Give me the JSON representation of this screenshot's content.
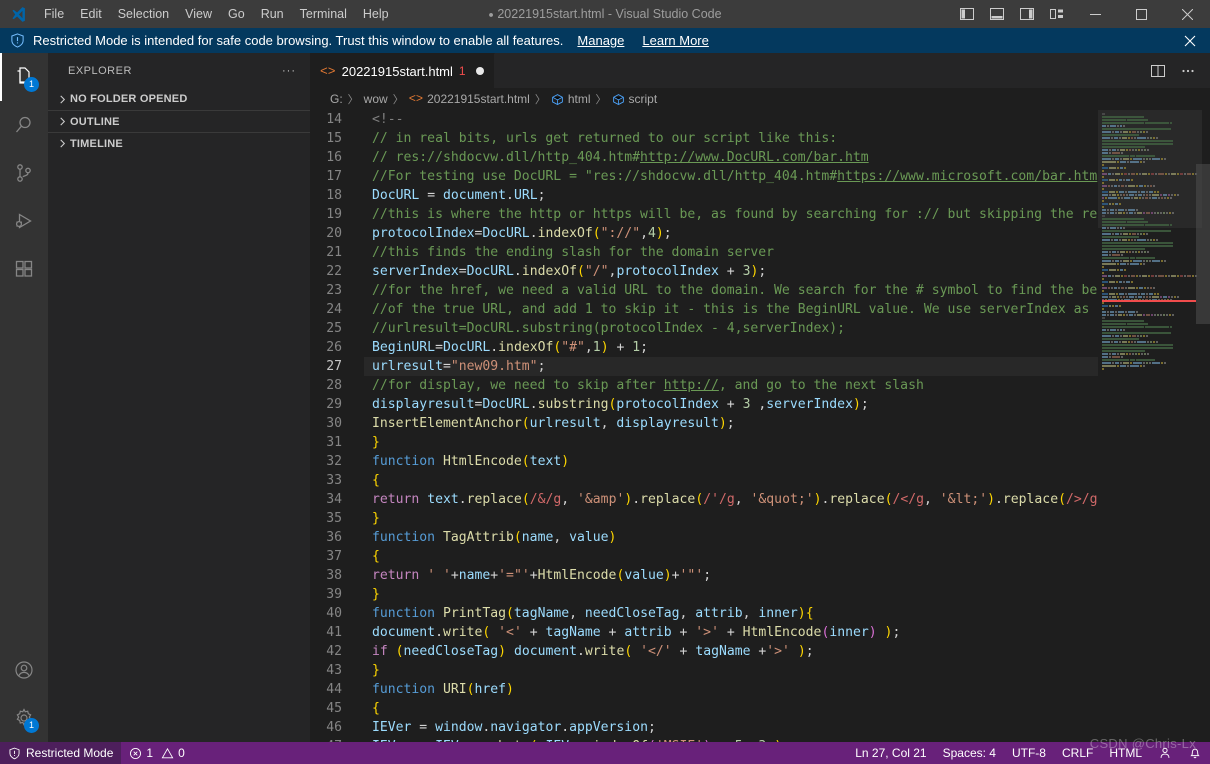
{
  "titlebar": {
    "menu": [
      "File",
      "Edit",
      "Selection",
      "View",
      "Go",
      "Run",
      "Terminal",
      "Help"
    ],
    "title": "20221915start.html - Visual Studio Code",
    "dirty_marker": "●",
    "layout_icons": [
      "toggle-primary-sidebar",
      "toggle-panel",
      "toggle-secondary-sidebar",
      "customize-layout"
    ],
    "window_controls": [
      "minimize",
      "maximize",
      "close"
    ]
  },
  "banner": {
    "text": "Restricted Mode is intended for safe code browsing. Trust this window to enable all features.",
    "links": [
      "Manage",
      "Learn More"
    ],
    "close_label": "✕",
    "bg": "#04395e"
  },
  "activitybar": {
    "items": [
      {
        "name": "explorer",
        "badge": "1",
        "active": true
      },
      {
        "name": "search",
        "badge": "",
        "active": false
      },
      {
        "name": "source-control",
        "badge": "",
        "active": false
      },
      {
        "name": "run-and-debug",
        "badge": "",
        "active": false
      },
      {
        "name": "extensions",
        "badge": "",
        "active": false
      }
    ],
    "bottom": [
      {
        "name": "accounts",
        "badge": ""
      },
      {
        "name": "manage-settings",
        "badge": "1"
      }
    ]
  },
  "sidebar": {
    "title": "EXPLORER",
    "more_actions": "···",
    "sections": [
      {
        "label": "NO FOLDER OPENED",
        "expanded": false
      },
      {
        "label": "OUTLINE",
        "expanded": false
      },
      {
        "label": "TIMELINE",
        "expanded": false
      }
    ]
  },
  "editor": {
    "tab": {
      "filename": "20221915start.html",
      "error_count": "1",
      "dirty": true,
      "icon": "<>"
    },
    "actions": [
      "split-editor-right",
      "more-actions"
    ],
    "breadcrumbs": [
      {
        "label": "G:",
        "icon": ""
      },
      {
        "label": "wow",
        "icon": ""
      },
      {
        "label": "20221915start.html",
        "icon": "code"
      },
      {
        "label": "html",
        "icon": "symbol"
      },
      {
        "label": "script",
        "icon": "symbol"
      }
    ],
    "separator": "〉",
    "current_line": 27,
    "first_visible_line": 14,
    "lines": [
      {
        "n": 14,
        "tokens": [
          [
            "tg",
            "<!--"
          ]
        ]
      },
      {
        "n": 15,
        "tokens": [
          [
            "c",
            "// in real bits, urls get returned to our script like this:"
          ]
        ]
      },
      {
        "n": 16,
        "tokens": [
          [
            "c",
            "// res://shdocvw.dll/http_404.htm#"
          ],
          [
            "cu",
            "http://www.DocURL.com/bar.htm"
          ]
        ]
      },
      {
        "n": 17,
        "tokens": [
          [
            "c",
            "//For testing use DocURL = \"res://shdocvw.dll/http_404.htm#"
          ],
          [
            "cu",
            "https://www.microsoft.com/bar.htm"
          ],
          [
            "c",
            "\""
          ]
        ]
      },
      {
        "n": 18,
        "tokens": [
          [
            "vr",
            "DocURL"
          ],
          [
            "op",
            " = "
          ],
          [
            "vr",
            "document"
          ],
          [
            "op",
            "."
          ],
          [
            "vr",
            "URL"
          ],
          [
            "op",
            ";"
          ]
        ]
      },
      {
        "n": 19,
        "tokens": [
          [
            "c",
            "//this is where the http or https will be, as found by searching for :// but skipping the res://"
          ]
        ]
      },
      {
        "n": 20,
        "tokens": [
          [
            "vr",
            "protocolIndex"
          ],
          [
            "op",
            "="
          ],
          [
            "vr",
            "DocURL"
          ],
          [
            "op",
            "."
          ],
          [
            "fn",
            "indexOf"
          ],
          [
            "br1",
            "("
          ],
          [
            "st",
            "\"://\""
          ],
          [
            "op",
            ","
          ],
          [
            "nu",
            "4"
          ],
          [
            "br1",
            ")"
          ],
          [
            "op",
            ";"
          ]
        ]
      },
      {
        "n": 21,
        "tokens": [
          [
            "c",
            "//this finds the ending slash for the domain server"
          ]
        ]
      },
      {
        "n": 22,
        "tokens": [
          [
            "vr",
            "serverIndex"
          ],
          [
            "op",
            "="
          ],
          [
            "vr",
            "DocURL"
          ],
          [
            "op",
            "."
          ],
          [
            "fn",
            "indexOf"
          ],
          [
            "br1",
            "("
          ],
          [
            "st",
            "\"/\""
          ],
          [
            "op",
            ","
          ],
          [
            "vr",
            "protocolIndex"
          ],
          [
            "op",
            " + "
          ],
          [
            "nu",
            "3"
          ],
          [
            "br1",
            ")"
          ],
          [
            "op",
            ";"
          ]
        ]
      },
      {
        "n": 23,
        "tokens": [
          [
            "c",
            "//for the href, we need a valid URL to the domain. We search for the # symbol to find the beginning"
          ]
        ]
      },
      {
        "n": 24,
        "tokens": [
          [
            "c",
            "//of the true URL, and add 1 to skip it - this is the BeginURL value. We use serverIndex as the end"
          ]
        ]
      },
      {
        "n": 25,
        "tokens": [
          [
            "c",
            "//urlresult=DocURL.substring(protocolIndex - 4,serverIndex);"
          ]
        ]
      },
      {
        "n": 26,
        "tokens": [
          [
            "vr",
            "BeginURL"
          ],
          [
            "op",
            "="
          ],
          [
            "vr",
            "DocURL"
          ],
          [
            "op",
            "."
          ],
          [
            "fn",
            "indexOf"
          ],
          [
            "br1",
            "("
          ],
          [
            "st",
            "\"#\""
          ],
          [
            "op",
            ","
          ],
          [
            "nu",
            "1"
          ],
          [
            "br1",
            ")"
          ],
          [
            "op",
            " + "
          ],
          [
            "nu",
            "1"
          ],
          [
            "op",
            ";"
          ]
        ]
      },
      {
        "n": 27,
        "tokens": [
          [
            "vr",
            "urlresult"
          ],
          [
            "op",
            "="
          ],
          [
            "st",
            "\"new09.htm\""
          ],
          [
            "op",
            ";"
          ]
        ]
      },
      {
        "n": 28,
        "tokens": [
          [
            "c",
            "//for display, we need to skip after "
          ],
          [
            "cu",
            "http://"
          ],
          [
            "c",
            ", and go to the next slash"
          ]
        ]
      },
      {
        "n": 29,
        "tokens": [
          [
            "vr",
            "displayresult"
          ],
          [
            "op",
            "="
          ],
          [
            "vr",
            "DocURL"
          ],
          [
            "op",
            "."
          ],
          [
            "fn",
            "substring"
          ],
          [
            "br1",
            "("
          ],
          [
            "vr",
            "protocolIndex"
          ],
          [
            "op",
            " + "
          ],
          [
            "nu",
            "3"
          ],
          [
            "op",
            " ,"
          ],
          [
            "vr",
            "serverIndex"
          ],
          [
            "br1",
            ")"
          ],
          [
            "op",
            ";"
          ]
        ]
      },
      {
        "n": 30,
        "tokens": [
          [
            "fn",
            "InsertElementAnchor"
          ],
          [
            "br1",
            "("
          ],
          [
            "vr",
            "urlresult"
          ],
          [
            "op",
            ", "
          ],
          [
            "vr",
            "displayresult"
          ],
          [
            "br1",
            ")"
          ],
          [
            "op",
            ";"
          ]
        ]
      },
      {
        "n": 31,
        "tokens": [
          [
            "br1",
            "}"
          ]
        ]
      },
      {
        "n": 32,
        "tokens": [
          [
            "kw",
            "function "
          ],
          [
            "fn",
            "HtmlEncode"
          ],
          [
            "br1",
            "("
          ],
          [
            "vr",
            "text"
          ],
          [
            "br1",
            ")"
          ]
        ]
      },
      {
        "n": 33,
        "tokens": [
          [
            "br1",
            "{"
          ]
        ]
      },
      {
        "n": 34,
        "tokens": [
          [
            "pu",
            "return "
          ],
          [
            "vr",
            "text"
          ],
          [
            "op",
            "."
          ],
          [
            "fn",
            "replace"
          ],
          [
            "br1",
            "("
          ],
          [
            "rx",
            "/&/g"
          ],
          [
            "op",
            ", "
          ],
          [
            "st",
            "'&amp'"
          ],
          [
            "br1",
            ")"
          ],
          [
            "op",
            "."
          ],
          [
            "fn",
            "replace"
          ],
          [
            "br1",
            "("
          ],
          [
            "rx",
            "/'/g"
          ],
          [
            "op",
            ", "
          ],
          [
            "st",
            "'&quot;'"
          ],
          [
            "br1",
            ")"
          ],
          [
            "op",
            "."
          ],
          [
            "fn",
            "replace"
          ],
          [
            "br1",
            "("
          ],
          [
            "rx",
            "/</g"
          ],
          [
            "op",
            ", "
          ],
          [
            "st",
            "'&lt;'"
          ],
          [
            "br1",
            ")"
          ],
          [
            "op",
            "."
          ],
          [
            "fn",
            "replace"
          ],
          [
            "br1",
            "("
          ],
          [
            "rx",
            "/>/g"
          ],
          [
            "op",
            ", "
          ],
          [
            "st",
            "'"
          ]
        ]
      },
      {
        "n": 35,
        "tokens": [
          [
            "br1",
            "}"
          ]
        ]
      },
      {
        "n": 36,
        "tokens": [
          [
            "kw",
            "function "
          ],
          [
            "fn",
            "TagAttrib"
          ],
          [
            "br1",
            "("
          ],
          [
            "vr",
            "name"
          ],
          [
            "op",
            ", "
          ],
          [
            "vr",
            "value"
          ],
          [
            "br1",
            ")"
          ]
        ]
      },
      {
        "n": 37,
        "tokens": [
          [
            "br1",
            "{"
          ]
        ]
      },
      {
        "n": 38,
        "tokens": [
          [
            "pu",
            "return "
          ],
          [
            "st",
            "' '"
          ],
          [
            "op",
            "+"
          ],
          [
            "vr",
            "name"
          ],
          [
            "op",
            "+"
          ],
          [
            "st",
            "'=\"'"
          ],
          [
            "op",
            "+"
          ],
          [
            "fn",
            "HtmlEncode"
          ],
          [
            "br1",
            "("
          ],
          [
            "vr",
            "value"
          ],
          [
            "br1",
            ")"
          ],
          [
            "op",
            "+"
          ],
          [
            "st",
            "'\"'"
          ],
          [
            "op",
            ";"
          ]
        ]
      },
      {
        "n": 39,
        "tokens": [
          [
            "br1",
            "}"
          ]
        ]
      },
      {
        "n": 40,
        "tokens": [
          [
            "kw",
            "function "
          ],
          [
            "fn",
            "PrintTag"
          ],
          [
            "br1",
            "("
          ],
          [
            "vr",
            "tagName"
          ],
          [
            "op",
            ", "
          ],
          [
            "vr",
            "needCloseTag"
          ],
          [
            "op",
            ", "
          ],
          [
            "vr",
            "attrib"
          ],
          [
            "op",
            ", "
          ],
          [
            "vr",
            "inner"
          ],
          [
            "br1",
            ")"
          ],
          [
            "br1",
            "{"
          ]
        ]
      },
      {
        "n": 41,
        "tokens": [
          [
            "vr",
            "document"
          ],
          [
            "op",
            "."
          ],
          [
            "fn",
            "write"
          ],
          [
            "br1",
            "("
          ],
          [
            "op",
            " "
          ],
          [
            "st",
            "'<'"
          ],
          [
            "op",
            " + "
          ],
          [
            "vr",
            "tagName"
          ],
          [
            "op",
            " + "
          ],
          [
            "vr",
            "attrib"
          ],
          [
            "op",
            " + "
          ],
          [
            "st",
            "'>'"
          ],
          [
            "op",
            " + "
          ],
          [
            "fn",
            "HtmlEncode"
          ],
          [
            "br2",
            "("
          ],
          [
            "vr",
            "inner"
          ],
          [
            "br2",
            ")"
          ],
          [
            "op",
            " "
          ],
          [
            "br1",
            ")"
          ],
          [
            "op",
            ";"
          ]
        ]
      },
      {
        "n": 42,
        "tokens": [
          [
            "pu",
            "if "
          ],
          [
            "br1",
            "("
          ],
          [
            "vr",
            "needCloseTag"
          ],
          [
            "br1",
            ")"
          ],
          [
            "op",
            " "
          ],
          [
            "vr",
            "document"
          ],
          [
            "op",
            "."
          ],
          [
            "fn",
            "write"
          ],
          [
            "br1",
            "("
          ],
          [
            "op",
            " "
          ],
          [
            "st",
            "'</'"
          ],
          [
            "op",
            " + "
          ],
          [
            "vr",
            "tagName"
          ],
          [
            "op",
            " +"
          ],
          [
            "st",
            "'>'"
          ],
          [
            "op",
            " "
          ],
          [
            "br1",
            ")"
          ],
          [
            "op",
            ";"
          ]
        ]
      },
      {
        "n": 43,
        "tokens": [
          [
            "br1",
            "}"
          ]
        ]
      },
      {
        "n": 44,
        "tokens": [
          [
            "kw",
            "function "
          ],
          [
            "fn",
            "URI"
          ],
          [
            "br1",
            "("
          ],
          [
            "vr",
            "href"
          ],
          [
            "br1",
            ")"
          ]
        ]
      },
      {
        "n": 45,
        "tokens": [
          [
            "br1",
            "{"
          ]
        ]
      },
      {
        "n": 46,
        "tokens": [
          [
            "vr",
            "IEVer"
          ],
          [
            "op",
            " = "
          ],
          [
            "vr",
            "window"
          ],
          [
            "op",
            "."
          ],
          [
            "vr",
            "navigator"
          ],
          [
            "op",
            "."
          ],
          [
            "vr",
            "appVersion"
          ],
          [
            "op",
            ";"
          ]
        ]
      },
      {
        "n": 47,
        "tokens": [
          [
            "vr",
            "IEVer"
          ],
          [
            "op",
            " = "
          ],
          [
            "vr",
            "IEVer"
          ],
          [
            "op",
            "."
          ],
          [
            "fn",
            "substr"
          ],
          [
            "br1",
            "("
          ],
          [
            "op",
            " "
          ],
          [
            "vr",
            "IEVer"
          ],
          [
            "op",
            "."
          ],
          [
            "fn",
            "indexOf"
          ],
          [
            "br2",
            "("
          ],
          [
            "st",
            "'MSIE'"
          ],
          [
            "br2",
            ")"
          ],
          [
            "op",
            " + "
          ],
          [
            "nu",
            "5"
          ],
          [
            "op",
            ", "
          ],
          [
            "nu",
            "3"
          ],
          [
            "op",
            " "
          ],
          [
            "br1",
            ")"
          ],
          [
            "op",
            ";"
          ]
        ]
      }
    ]
  },
  "statusbar": {
    "restricted_mode": "Restricted Mode",
    "errors": "1",
    "warnings": "0",
    "cursor_position": "Ln 27, Col 21",
    "indentation": "Spaces: 4",
    "encoding": "UTF-8",
    "eol": "CRLF",
    "language": "HTML",
    "right_icons": [
      "feedback-smiley",
      "notifications-bell"
    ],
    "bg": "#68217a"
  },
  "watermark": "CSDN @Chris-Lx"
}
